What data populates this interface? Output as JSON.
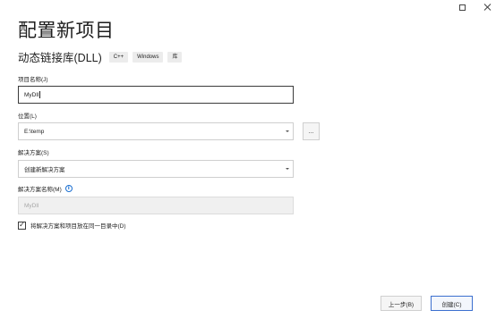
{
  "window_controls": {
    "maximize_icon": "maximize-icon",
    "close_icon": "close-icon"
  },
  "page": {
    "title": "配置新项目",
    "template_name": "动态链接库(DLL)",
    "tags": [
      "C++",
      "Windows",
      "库"
    ]
  },
  "form": {
    "project_name": {
      "label": "项目名称(J)",
      "value": "MyDll"
    },
    "location": {
      "label": "位置(L)",
      "value": "E:\\temp",
      "browse_label": "..."
    },
    "solution": {
      "label": "解决方案(S)",
      "value": "创建新解决方案"
    },
    "solution_name": {
      "label": "解决方案名称(M)",
      "value": "MyDll",
      "info_glyph": "i"
    },
    "same_directory": {
      "label": "将解决方案和项目放在同一目录中(D)",
      "checked": true,
      "check_glyph": "✓"
    }
  },
  "footer": {
    "back_label": "上一步(B)",
    "create_label": "创建(C)"
  },
  "colors": {
    "accent": "#3b6fcf",
    "info": "#1b6fd1",
    "disabled_bg": "#f0f0f0"
  }
}
